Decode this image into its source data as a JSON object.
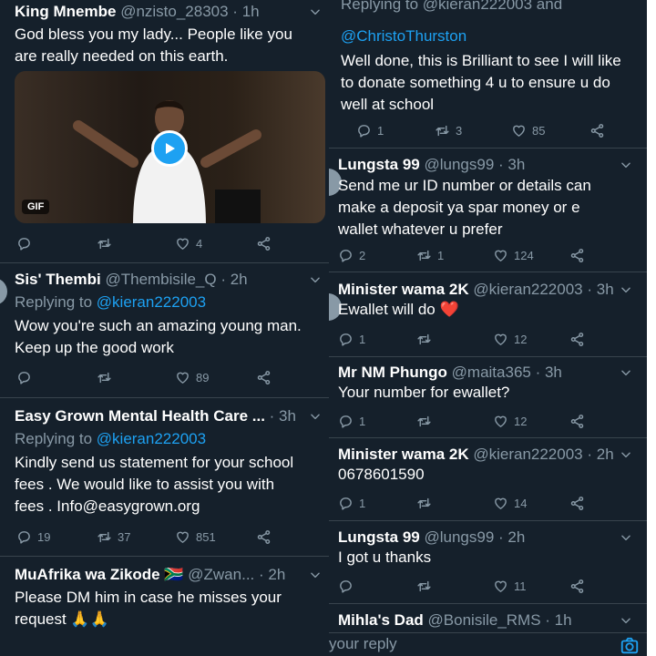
{
  "left": {
    "t1": {
      "name": "King Mnembe",
      "handle": "@nzisto_28303 · 1h",
      "text": [
        "God bless you my lady... People like you",
        "are really needed on this earth."
      ],
      "media_badge": "GIF",
      "likes": "4"
    },
    "t2": {
      "name": "Sis' Thembi",
      "handle": "@Thembisile_Q · 2h",
      "reply_prefix": "Replying to ",
      "reply_handle": "@kieran222003",
      "text": [
        "Wow you're such an amazing young man.",
        "Keep up the good work"
      ],
      "likes": "89"
    },
    "t3": {
      "name": "Easy Grown Mental Health Care ...",
      "handle": "· 3h",
      "reply_prefix": "Replying to ",
      "reply_handle": "@kieran222003",
      "text": [
        "Kindly send us statement for your school",
        "fees . We would like to assist you with",
        "fees . Info@easygrown.org"
      ],
      "replies": "19",
      "retweets": "37",
      "likes": "851"
    },
    "t4": {
      "name": "MuAfrika wa Zikode 🇿🇦",
      "handle": "@Zwan... · 2h",
      "text": [
        "Please DM him in case he misses your",
        "request 🙏🙏"
      ]
    }
  },
  "right": {
    "t0": {
      "reply_cut": "Replying to @kieran222003 and",
      "reply_handle": "@ChristoThurston",
      "text": [
        "Well done, this is Brilliant to see I will like",
        "to donate something 4 u to ensure u do",
        "well at school"
      ],
      "replies": "1",
      "retweets": "3",
      "likes": "85"
    },
    "t1": {
      "name": "Lungsta 99",
      "handle": "@lungs99 · 3h",
      "text": [
        "Send me ur ID number or details can",
        "make a deposit ya spar money or e",
        "wallet whatever u prefer"
      ],
      "replies": "2",
      "retweets": "1",
      "likes": "124"
    },
    "t2": {
      "name": "Minister wama 2K",
      "handle": "@kieran222003 · 3h",
      "text": [
        "Ewallet will do ❤️"
      ],
      "replies": "1",
      "likes": "12"
    },
    "t3": {
      "name": "Mr NM Phungo",
      "handle": "@maita365 · 3h",
      "text": [
        "Your number for ewallet?"
      ],
      "replies": "1",
      "likes": "12"
    },
    "t4": {
      "name": "Minister wama 2K",
      "handle": "@kieran222003 · 2h",
      "text": [
        "0678601590"
      ],
      "replies": "1",
      "likes": "14"
    },
    "t5": {
      "name": "Lungsta 99",
      "handle": "@lungs99 · 2h",
      "text": [
        "I got u thanks"
      ],
      "likes": "11"
    },
    "t6": {
      "name": "Mihla's Dad",
      "handle": "@Bonisile_RMS · 1h"
    },
    "composer_placeholder": "your reply"
  },
  "colors": {
    "background": "#15202b",
    "text": "#ffffff",
    "muted": "#8899a6",
    "accent": "#1da1f2",
    "divider": "#38444d"
  }
}
